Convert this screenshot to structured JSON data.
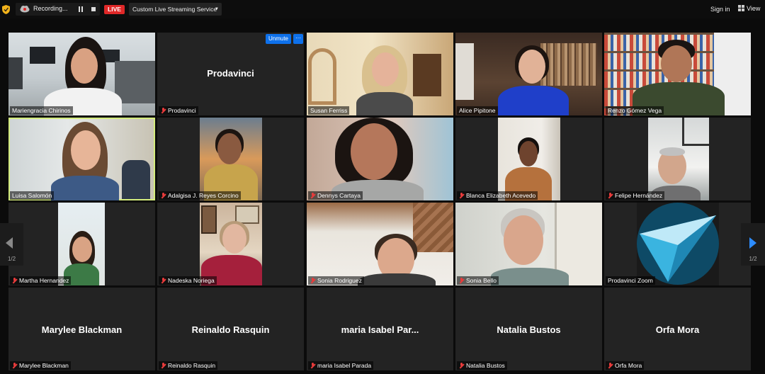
{
  "topbar": {
    "recording_label": "Recording...",
    "live_label": "LIVE",
    "stream_service": "Custom Live Streaming Service",
    "signin_label": "Sign in",
    "view_label": "View"
  },
  "tiles": {
    "t0": {
      "name": "Mariengracia Chirinos"
    },
    "t1": {
      "name": "Prodavinci",
      "big": "Prodavinci",
      "unmute": "Unmute",
      "more": "···"
    },
    "t2": {
      "name": "Susan Ferriss"
    },
    "t3": {
      "name": "Alice Pipitone"
    },
    "t4": {
      "name": "Renzo Gómez Vega"
    },
    "t5": {
      "name": "Luisa Salomón"
    },
    "t6": {
      "name": "Adalgisa J. Reyes Corcino"
    },
    "t7": {
      "name": "Dennys Cartaya"
    },
    "t8": {
      "name": "Blanca Elizabeth Acevedo"
    },
    "t9": {
      "name": "Felipe Hernández"
    },
    "t10": {
      "name": "Martha Hernandez"
    },
    "t11": {
      "name": "Nadeska Noriega"
    },
    "t12": {
      "name": "Sonia Rodriguez"
    },
    "t13": {
      "name": "Sonia Bello"
    },
    "t14": {
      "name": "Prodavinci Zoom"
    },
    "t15": {
      "name": "Marylee Blackman",
      "big": "Marylee Blackman"
    },
    "t16": {
      "name": "Reinaldo Rasquin",
      "big": "Reinaldo Rasquin"
    },
    "t17": {
      "name": "maria Isabel Parada",
      "big": "maria Isabel Par..."
    },
    "t18": {
      "name": "Natalia Bustos",
      "big": "Natalia Bustos"
    },
    "t19": {
      "name": "Orfa Mora",
      "big": "Orfa Mora"
    }
  },
  "nav": {
    "left_page": "1/2",
    "right_page": "1/2"
  },
  "colors": {
    "live": "#e02828",
    "accent": "#0e71eb",
    "active_speaker": "#d4ec7d",
    "muted": "#e83b3b"
  }
}
